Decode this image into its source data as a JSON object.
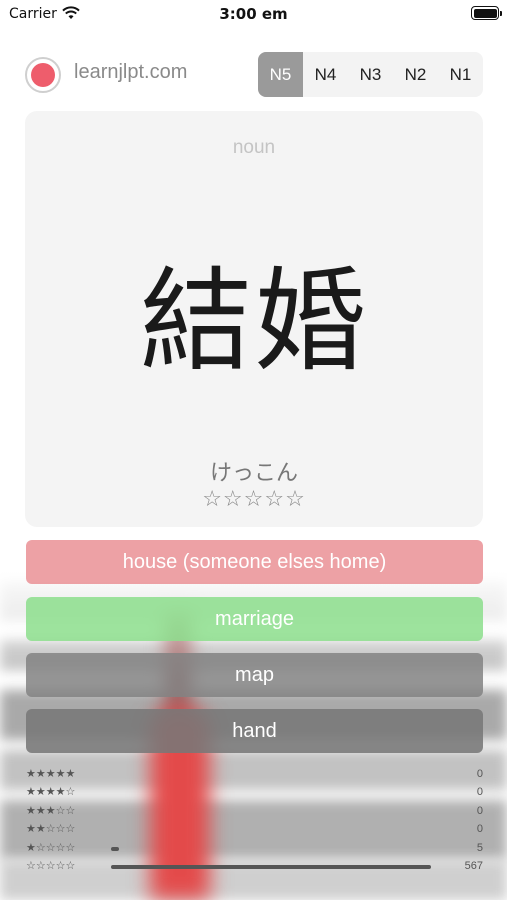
{
  "status_bar": {
    "carrier": "Carrier",
    "time": "3:00 em"
  },
  "header": {
    "site_name": "learnjlpt.com",
    "levels": [
      "N5",
      "N4",
      "N3",
      "N2",
      "N1"
    ],
    "active_level": "N5"
  },
  "card": {
    "part_of_speech": "noun",
    "kanji": "結婚",
    "reading": "けっこん",
    "rating_stars": "☆☆☆☆☆"
  },
  "answers": [
    {
      "label": "house (someone elses home)",
      "state": "wrong"
    },
    {
      "label": "marriage",
      "state": "correct"
    },
    {
      "label": "map",
      "state": "neutral"
    },
    {
      "label": "hand",
      "state": "neutral"
    }
  ],
  "stats": [
    {
      "stars": "★★★★★",
      "count": "0",
      "fraction": 0
    },
    {
      "stars": "★★★★☆",
      "count": "0",
      "fraction": 0
    },
    {
      "stars": "★★★☆☆",
      "count": "0",
      "fraction": 0
    },
    {
      "stars": "★★☆☆☆",
      "count": "0",
      "fraction": 0
    },
    {
      "stars": "★☆☆☆☆",
      "count": "5",
      "fraction": 0.009
    },
    {
      "stars": "☆☆☆☆☆",
      "count": "567",
      "fraction": 1.0
    }
  ],
  "colors": {
    "wrong": "#e98c91",
    "correct": "#8cde8c",
    "neutral": "#828282",
    "active_level": "#9a9a9a",
    "logo": "#ee5d6c"
  }
}
